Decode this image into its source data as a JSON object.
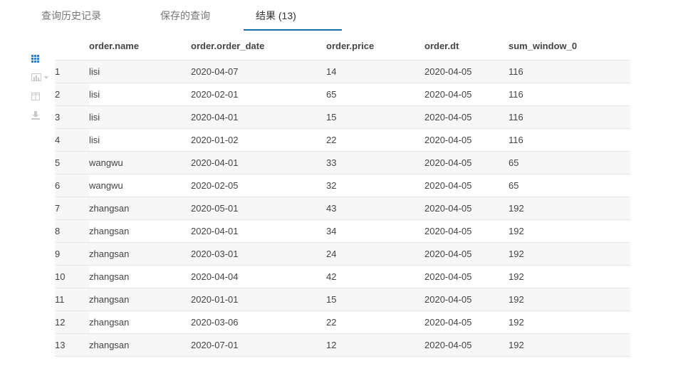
{
  "tabs": [
    {
      "label": "查询历史记录"
    },
    {
      "label": "保存的查询"
    },
    {
      "label": "结果 (13)"
    }
  ],
  "toolbar": {
    "icons": [
      "grid-icon",
      "bar-chart-icon",
      "columns-icon",
      "download-icon"
    ]
  },
  "colors": {
    "accent": "#1f6fa8",
    "stripe": "#f7f7f7",
    "active_icon": "#3a7bbf",
    "inactive_icon": "#c9c9c9"
  },
  "table": {
    "columns": [
      "order.name",
      "order.order_date",
      "order.price",
      "order.dt",
      "sum_window_0"
    ],
    "rows": [
      [
        "1",
        "lisi",
        "2020-04-07",
        "14",
        "2020-04-05",
        "116"
      ],
      [
        "2",
        "lisi",
        "2020-02-01",
        "65",
        "2020-04-05",
        "116"
      ],
      [
        "3",
        "lisi",
        "2020-04-01",
        "15",
        "2020-04-05",
        "116"
      ],
      [
        "4",
        "lisi",
        "2020-01-02",
        "22",
        "2020-04-05",
        "116"
      ],
      [
        "5",
        "wangwu",
        "2020-04-01",
        "33",
        "2020-04-05",
        "65"
      ],
      [
        "6",
        "wangwu",
        "2020-02-05",
        "32",
        "2020-04-05",
        "65"
      ],
      [
        "7",
        "zhangsan",
        "2020-05-01",
        "43",
        "2020-04-05",
        "192"
      ],
      [
        "8",
        "zhangsan",
        "2020-04-01",
        "34",
        "2020-04-05",
        "192"
      ],
      [
        "9",
        "zhangsan",
        "2020-03-01",
        "24",
        "2020-04-05",
        "192"
      ],
      [
        "10",
        "zhangsan",
        "2020-04-04",
        "42",
        "2020-04-05",
        "192"
      ],
      [
        "11",
        "zhangsan",
        "2020-01-01",
        "15",
        "2020-04-05",
        "192"
      ],
      [
        "12",
        "zhangsan",
        "2020-03-06",
        "22",
        "2020-04-05",
        "192"
      ],
      [
        "13",
        "zhangsan",
        "2020-07-01",
        "12",
        "2020-04-05",
        "192"
      ]
    ]
  }
}
